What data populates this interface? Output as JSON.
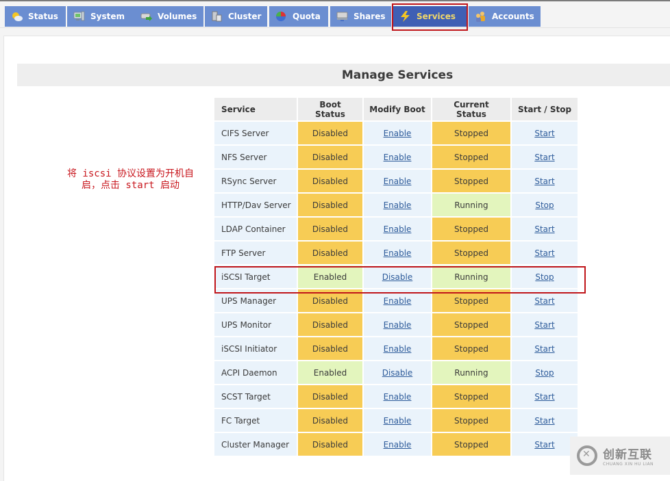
{
  "tabs": [
    {
      "label": "Status",
      "icon": "weather-sun-cloud-icon",
      "active": false
    },
    {
      "label": "System",
      "icon": "computer-monitor-icon",
      "active": false
    },
    {
      "label": "Volumes",
      "icon": "drive-arrow-icon",
      "active": false
    },
    {
      "label": "Cluster",
      "icon": "cluster-servers-icon",
      "active": false
    },
    {
      "label": "Quota",
      "icon": "pie-chart-icon",
      "active": false
    },
    {
      "label": "Shares",
      "icon": "shared-drive-icon",
      "active": false
    },
    {
      "label": "Services",
      "icon": "lightning-bolt-icon",
      "active": true
    },
    {
      "label": "Accounts",
      "icon": "users-icon",
      "active": false
    }
  ],
  "page_title": "Manage Services",
  "annotation": {
    "line1": "将 iscsi 协议设置为开机自",
    "line2": "启，点击 start 启动"
  },
  "table": {
    "headers": [
      "Service",
      "Boot Status",
      "Modify Boot",
      "Current Status",
      "Start / Stop"
    ],
    "rows": [
      {
        "service": "CIFS Server",
        "boot_status": "Disabled",
        "modify": "Enable",
        "current": "Stopped",
        "action": "Start"
      },
      {
        "service": "NFS Server",
        "boot_status": "Disabled",
        "modify": "Enable",
        "current": "Stopped",
        "action": "Start"
      },
      {
        "service": "RSync Server",
        "boot_status": "Disabled",
        "modify": "Enable",
        "current": "Stopped",
        "action": "Start"
      },
      {
        "service": "HTTP/Dav Server",
        "boot_status": "Disabled",
        "modify": "Enable",
        "current": "Running",
        "action": "Stop"
      },
      {
        "service": "LDAP Container",
        "boot_status": "Disabled",
        "modify": "Enable",
        "current": "Stopped",
        "action": "Start"
      },
      {
        "service": "FTP Server",
        "boot_status": "Disabled",
        "modify": "Enable",
        "current": "Stopped",
        "action": "Start"
      },
      {
        "service": "iSCSI Target",
        "boot_status": "Enabled",
        "modify": "Disable",
        "current": "Running",
        "action": "Stop"
      },
      {
        "service": "UPS Manager",
        "boot_status": "Disabled",
        "modify": "Enable",
        "current": "Stopped",
        "action": "Start"
      },
      {
        "service": "UPS Monitor",
        "boot_status": "Disabled",
        "modify": "Enable",
        "current": "Stopped",
        "action": "Start"
      },
      {
        "service": "iSCSI Initiator",
        "boot_status": "Disabled",
        "modify": "Enable",
        "current": "Stopped",
        "action": "Start"
      },
      {
        "service": "ACPI Daemon",
        "boot_status": "Enabled",
        "modify": "Disable",
        "current": "Running",
        "action": "Stop"
      },
      {
        "service": "SCST Target",
        "boot_status": "Disabled",
        "modify": "Enable",
        "current": "Stopped",
        "action": "Start"
      },
      {
        "service": "FC Target",
        "boot_status": "Disabled",
        "modify": "Enable",
        "current": "Stopped",
        "action": "Start"
      },
      {
        "service": "Cluster Manager",
        "boot_status": "Disabled",
        "modify": "Enable",
        "current": "Stopped",
        "action": "Start"
      }
    ]
  },
  "colors": {
    "tab_bg": "#6b8ed1",
    "tab_active_bg": "#3f5fb4",
    "tab_active_text": "#f0d76a",
    "status_off": "#f7cc55",
    "status_on": "#e3f5bd",
    "highlight_box": "#c0151a",
    "annotation_text": "#c8161d"
  },
  "watermark": {
    "cn": "创新互联",
    "en": "CHUANG XIN HU LIAN"
  }
}
